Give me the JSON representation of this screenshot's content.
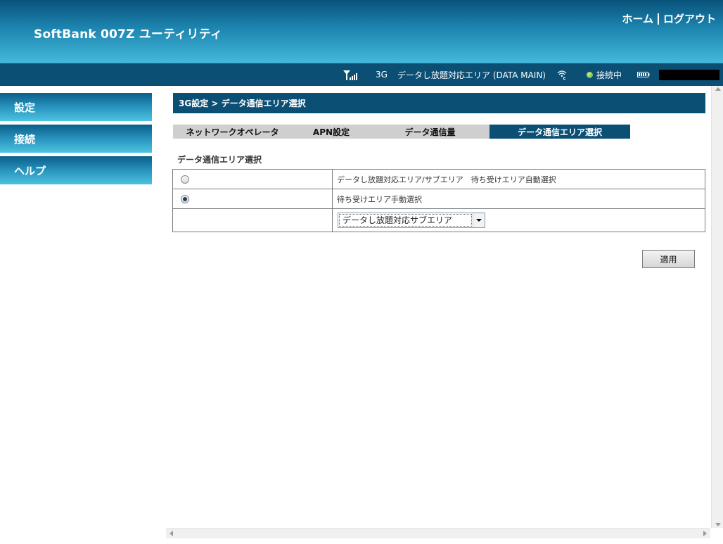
{
  "header": {
    "app_title": "SoftBank 007Z ユーティリティ",
    "home_link": "ホーム",
    "logout_link": "ログアウト"
  },
  "status": {
    "network_type": "3G",
    "area": "データし放題対応エリア (DATA MAIN)",
    "connection": "接続中",
    "colors": {
      "connected_dot": "#58a81a"
    }
  },
  "sidebar": {
    "items": [
      {
        "label": "設定"
      },
      {
        "label": "接続"
      },
      {
        "label": "ヘルプ"
      }
    ]
  },
  "main": {
    "breadcrumb": "3G設定 > データ通信エリア選択",
    "tabs": [
      {
        "label": "ネットワークオペレータ",
        "active": false
      },
      {
        "label": "APN設定",
        "active": false
      },
      {
        "label": "データ通信量",
        "active": false
      },
      {
        "label": "データ通信エリア選択",
        "active": true
      }
    ],
    "section_title": "データ通信エリア選択",
    "options": [
      {
        "label": "データし放題対応エリア/サブエリア　待ち受けエリア自動選択",
        "checked": false
      },
      {
        "label": "待ち受けエリア手動選択",
        "checked": true
      }
    ],
    "area_select": {
      "value": "データし放題対応サブエリア"
    },
    "apply_button": "適用"
  },
  "theme": {
    "header_dark": "#08527a",
    "accent_navy": "#0c4f75",
    "sidebar_light": "#4dc3e0"
  }
}
